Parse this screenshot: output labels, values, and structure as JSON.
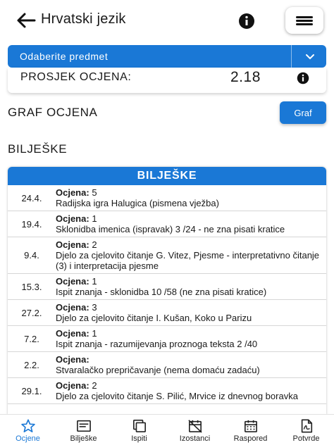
{
  "header": {
    "title": "Hrvatski jezik",
    "back_icon": "arrow-left-icon",
    "info_icon": "info-icon",
    "menu_icon": "hamburger-menu-icon"
  },
  "subject_select": {
    "label": "Odaberite predmet",
    "caret_icon": "chevron-down-icon"
  },
  "average": {
    "label": "PROSJEK OCJENA:",
    "value": "2.18"
  },
  "graph": {
    "title": "GRAF OCJENA",
    "button_label": "Graf"
  },
  "notes": {
    "section_title": "BILJEŠKE",
    "table_title": "BILJEŠKE",
    "grade_label": "Ocjena:",
    "rows": [
      {
        "date": "24.4.",
        "grade": "5",
        "text": "Radijska igra Halugica (pismena vježba)"
      },
      {
        "date": "19.4.",
        "grade": "1",
        "text": "Sklonidba imenica (ispravak) 3 /24 - ne zna pisati kratice"
      },
      {
        "date": "9.4.",
        "grade": "2",
        "text": "Djelo za cjelovito čitanje G. Vitez, Pjesme - interpretativno čitanje (3) i interpretacija pjesme"
      },
      {
        "date": "15.3.",
        "grade": "1",
        "text": "Ispit znanja - sklonidba 10 /58 (ne zna pisati kratice)"
      },
      {
        "date": "27.2.",
        "grade": "3",
        "text": "Djelo za cjelovito čitanje I. Kušan, Koko u Parizu"
      },
      {
        "date": "7.2.",
        "grade": "1",
        "text": "Ispit znanja - razumijevanja proznoga teksta 2 /40"
      },
      {
        "date": "2.2.",
        "grade": "",
        "text": "Stvaralačko prepričavanje (nema domaću zadaću)"
      },
      {
        "date": "29.1.",
        "grade": "2",
        "text": "Djelo za cjelovito čitanje S. Pilić, Mrvice iz dnevnog boravka"
      }
    ]
  },
  "tabs": [
    {
      "label": "Ocjene",
      "icon": "star-icon",
      "active": true
    },
    {
      "label": "Bilješke",
      "icon": "notes-icon",
      "active": false
    },
    {
      "label": "Ispiti",
      "icon": "copy-icon",
      "active": false
    },
    {
      "label": "Izostanci",
      "icon": "calendar-off-icon",
      "active": false
    },
    {
      "label": "Raspored",
      "icon": "calendar-icon",
      "active": false
    },
    {
      "label": "Potvrde",
      "icon": "pdf-icon",
      "active": false
    }
  ],
  "colors": {
    "accent": "#1a78d6",
    "text": "#1a1a1a"
  }
}
